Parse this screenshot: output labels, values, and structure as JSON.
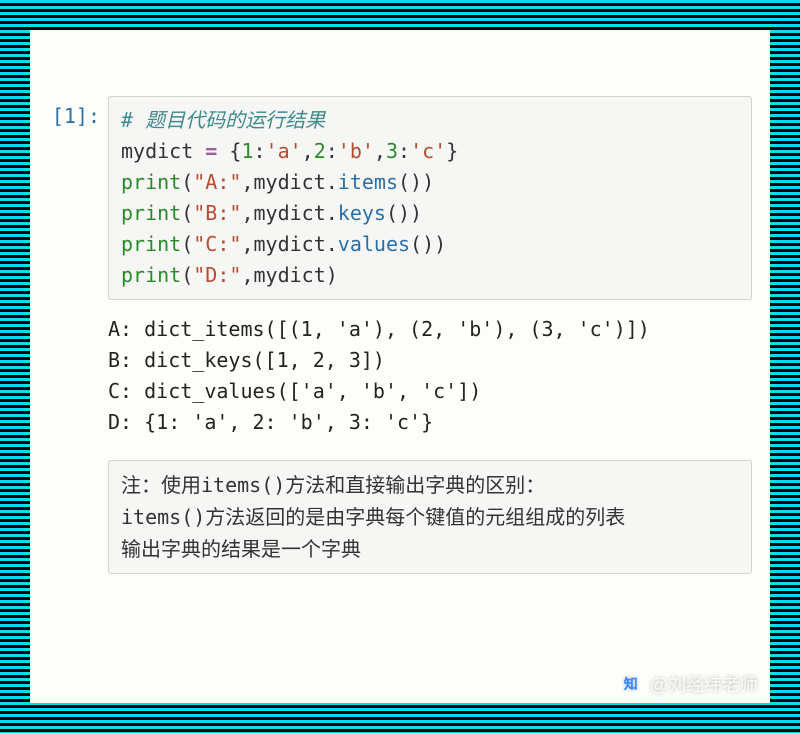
{
  "prompt": "[1]:",
  "code": {
    "lines": [
      {
        "type": "comment",
        "text": "# 题目代码的运行结果"
      },
      {
        "type": "assign",
        "var": "mydict",
        "op": "=",
        "dict": [
          [
            1,
            "'a'"
          ],
          [
            2,
            "'b'"
          ],
          [
            3,
            "'c'"
          ]
        ]
      },
      {
        "type": "print",
        "label": "\"A:\"",
        "expr_obj": "mydict",
        "expr_method": "items"
      },
      {
        "type": "print",
        "label": "\"B:\"",
        "expr_obj": "mydict",
        "expr_method": "keys"
      },
      {
        "type": "print",
        "label": "\"C:\"",
        "expr_obj": "mydict",
        "expr_method": "values"
      },
      {
        "type": "printvar",
        "label": "\"D:\"",
        "expr_obj": "mydict"
      }
    ]
  },
  "output": [
    "A: dict_items([(1, 'a'), (2, 'b'), (3, 'c')])",
    "B: dict_keys([1, 2, 3])",
    "C: dict_values(['a', 'b', 'c'])",
    "D: {1: 'a', 2: 'b', 3: 'c'}"
  ],
  "note": {
    "line1_pre": "注：使用",
    "line1_code": "items()",
    "line1_post": "方法和直接输出字典的区别：",
    "line2_code": "items()",
    "line2_post": "方法返回的是由字典每个键值的元组组成的列表",
    "line3": "输出字典的结果是一个字典"
  },
  "watermark": {
    "logo": "知",
    "text": "@刘经纬老师"
  }
}
